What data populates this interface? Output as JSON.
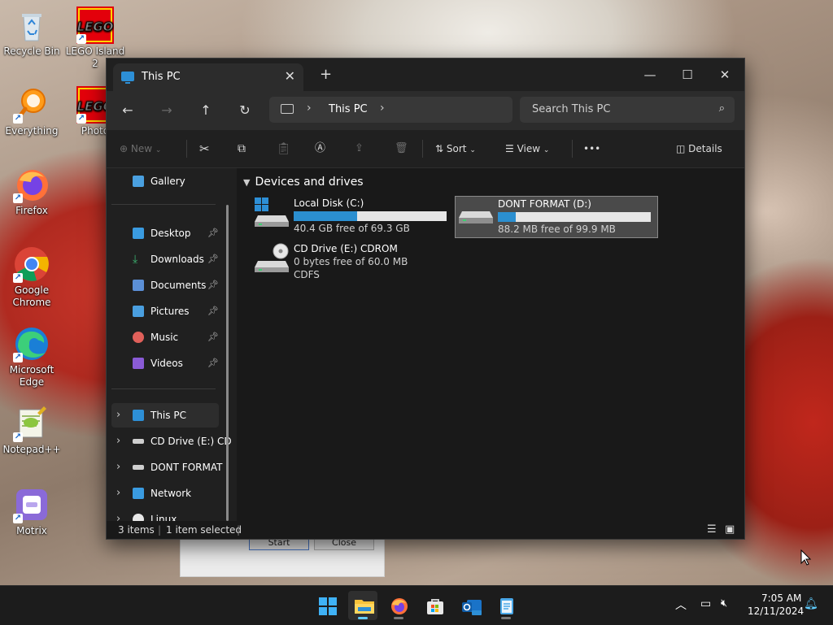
{
  "desktop": {
    "icons": [
      {
        "label": "Recycle Bin"
      },
      {
        "label": "LEGO Island 2"
      },
      {
        "label": "Everything"
      },
      {
        "label": "Photo"
      },
      {
        "label": "Firefox"
      },
      {
        "label": "Google Chrome"
      },
      {
        "label": "Microsoft Edge"
      },
      {
        "label": "Notepad++"
      },
      {
        "label": "Motrix"
      }
    ]
  },
  "background_dialog": {
    "start_label": "Start",
    "close_label": "Close"
  },
  "explorer": {
    "tab_title": "This PC",
    "new_tab_glyph": "+",
    "breadcrumb": [
      "This PC"
    ],
    "search_placeholder": "Search This PC",
    "toolbar": {
      "new_label": "New",
      "sort_label": "Sort",
      "view_label": "View",
      "more_label": "•••",
      "details_label": "Details"
    },
    "nav": {
      "gallery": "Gallery",
      "quick_access": [
        {
          "label": "Desktop",
          "color": "#3a9be0"
        },
        {
          "label": "Downloads",
          "color": "#3cb371"
        },
        {
          "label": "Documents",
          "color": "#5b8fd6"
        },
        {
          "label": "Pictures",
          "color": "#4a9fe0"
        },
        {
          "label": "Music",
          "color": "#e0605a"
        },
        {
          "label": "Videos",
          "color": "#8a5bd6"
        }
      ],
      "tree": [
        {
          "label": "This PC"
        },
        {
          "label": "CD Drive (E:) CD"
        },
        {
          "label": "DONT FORMAT"
        },
        {
          "label": "Network"
        },
        {
          "label": "Linux"
        }
      ]
    },
    "group_header": "Devices and drives",
    "drives": [
      {
        "name": "Local Disk (C:)",
        "free_text": "40.4 GB free of 69.3 GB",
        "used_fraction": 0.417,
        "filesystem": ""
      },
      {
        "name": "DONT FORMAT (D:)",
        "free_text": "88.2 MB free of 99.9 MB",
        "used_fraction": 0.117,
        "filesystem": ""
      },
      {
        "name": "CD Drive (E:) CDROM",
        "free_text": "0 bytes free of 60.0 MB",
        "used_fraction": null,
        "filesystem": "CDFS"
      }
    ],
    "status": {
      "items": "3 items",
      "selected": "1 item selected"
    }
  },
  "taskbar": {
    "time": "7:05 AM",
    "date": "12/11/2024",
    "apps": [
      {
        "name": "start-icon"
      },
      {
        "name": "file-explorer-icon"
      },
      {
        "name": "firefox-icon"
      },
      {
        "name": "microsoft-store-icon"
      },
      {
        "name": "outlook-icon"
      },
      {
        "name": "notepad-icon"
      }
    ]
  }
}
